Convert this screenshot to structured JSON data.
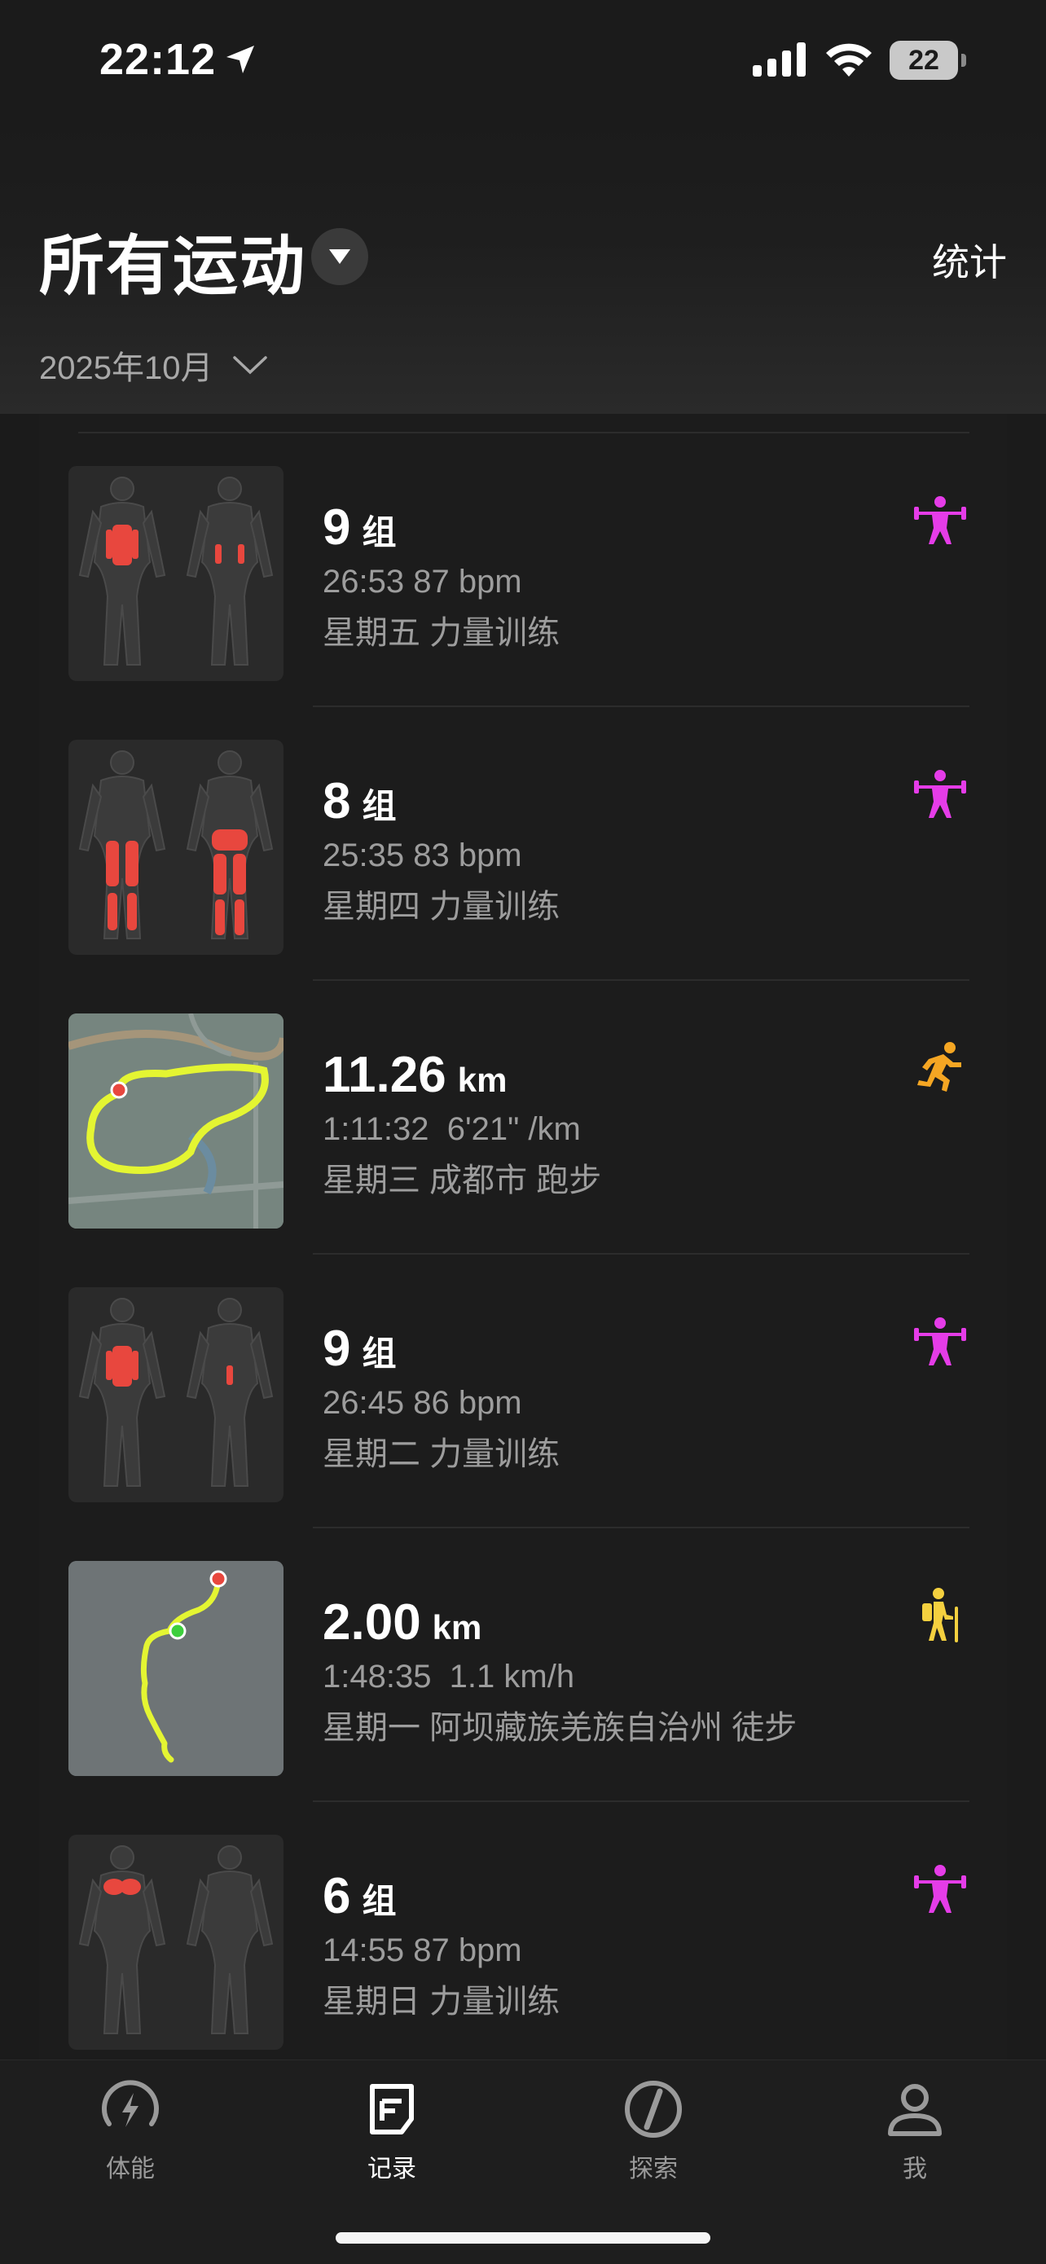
{
  "status_bar": {
    "time": "22:12",
    "battery": "22"
  },
  "header": {
    "title": "所有运动",
    "stats_label": "统计",
    "month": "2025年10月"
  },
  "colors": {
    "strength_icon": "#e53ce8",
    "run_icon": "#f5a623",
    "hike_icon": "#f4d03f",
    "muscle_highlight": "#e8473e",
    "route": "#e4f532"
  },
  "activities": [
    {
      "type": "strength",
      "thumbnail": "muscle-core",
      "primary_value": "9",
      "primary_unit": "组",
      "secondary": "26:53 87 bpm",
      "tertiary": "星期五 力量训练",
      "icon": "weightlifter-icon"
    },
    {
      "type": "strength",
      "thumbnail": "muscle-legs",
      "primary_value": "8",
      "primary_unit": "组",
      "secondary": "25:35 83 bpm",
      "tertiary": "星期四 力量训练",
      "icon": "weightlifter-icon"
    },
    {
      "type": "run",
      "thumbnail": "route-map-loop",
      "primary_value": "11.26",
      "primary_unit": "km",
      "secondary": "1:11:32  6'21\" /km",
      "tertiary": "星期三 成都市 跑步",
      "icon": "runner-icon"
    },
    {
      "type": "strength",
      "thumbnail": "muscle-core",
      "primary_value": "9",
      "primary_unit": "组",
      "secondary": "26:45 86 bpm",
      "tertiary": "星期二 力量训练",
      "icon": "weightlifter-icon"
    },
    {
      "type": "hike",
      "thumbnail": "route-map-trail",
      "primary_value": "2.00",
      "primary_unit": "km",
      "secondary": "1:48:35  1.1 km/h",
      "tertiary": "星期一 阿坝藏族羌族自治州 徒步",
      "icon": "hiker-icon"
    },
    {
      "type": "strength",
      "thumbnail": "muscle-chest",
      "primary_value": "6",
      "primary_unit": "组",
      "secondary": "14:55 87 bpm",
      "tertiary": "星期日 力量训练",
      "icon": "weightlifter-icon"
    }
  ],
  "tabs": [
    {
      "label": "体能",
      "icon": "fitness-bolt-icon",
      "active": false
    },
    {
      "label": "记录",
      "icon": "records-icon",
      "active": true
    },
    {
      "label": "探索",
      "icon": "explore-compass-icon",
      "active": false
    },
    {
      "label": "我",
      "icon": "profile-icon",
      "active": false
    }
  ]
}
